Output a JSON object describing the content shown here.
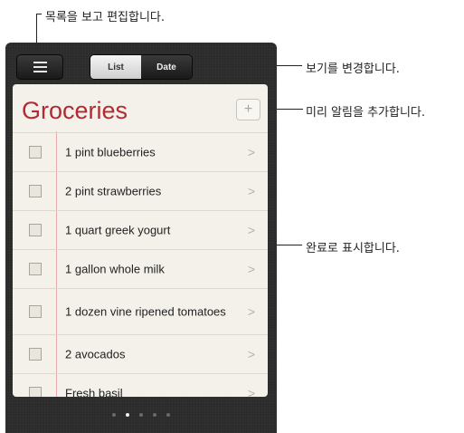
{
  "callouts": {
    "menu": "목록을 보고 편집합니다.",
    "view": "보기를 변경합니다.",
    "add": "미리 알림을 추가합니다.",
    "complete": "완료로 표시합니다."
  },
  "toolbar": {
    "view_options": [
      "List",
      "Date"
    ],
    "selected_view": "List"
  },
  "list": {
    "title": "Groceries",
    "add_glyph": "+",
    "items": [
      {
        "label": "1 pint blueberries",
        "checked": false
      },
      {
        "label": "2 pint strawberries",
        "checked": false
      },
      {
        "label": "1 quart greek yogurt",
        "checked": false
      },
      {
        "label": "1 gallon whole milk",
        "checked": false
      },
      {
        "label": "1 dozen vine ripened tomatoes",
        "checked": false
      },
      {
        "label": "2 avocados",
        "checked": false
      },
      {
        "label": "Fresh basil",
        "checked": false
      }
    ]
  },
  "pager": {
    "count": 5,
    "active": 1
  }
}
